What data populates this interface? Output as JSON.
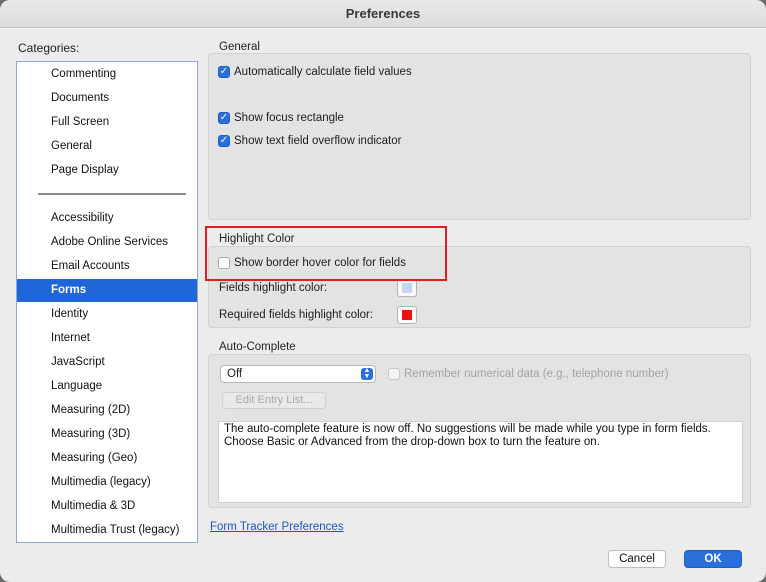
{
  "window": {
    "title": "Preferences"
  },
  "categories": {
    "label": "Categories:",
    "group1": [
      "Commenting",
      "Documents",
      "Full Screen",
      "General",
      "Page Display"
    ],
    "group2": [
      "Accessibility",
      "Adobe Online Services",
      "Email Accounts",
      "Forms",
      "Identity",
      "Internet",
      "JavaScript",
      "Language",
      "Measuring (2D)",
      "Measuring (3D)",
      "Measuring (Geo)",
      "Multimedia (legacy)",
      "Multimedia & 3D",
      "Multimedia Trust (legacy)"
    ],
    "selected": "Forms"
  },
  "general": {
    "title": "General",
    "auto_calc": {
      "label": "Automatically calculate field values",
      "checked": true
    },
    "focus_rect": {
      "label": "Show focus rectangle",
      "checked": true
    },
    "overflow": {
      "label": "Show text field overflow indicator",
      "checked": true
    }
  },
  "highlight": {
    "title": "Highlight Color",
    "border_hover": {
      "label": "Show border hover color for fields",
      "checked": false
    },
    "fields_color_label": "Fields highlight color:",
    "fields_color": "#c8d4f0",
    "required_color_label": "Required fields highlight color:",
    "required_color": "#ee1111"
  },
  "autocomplete": {
    "title": "Auto-Complete",
    "mode": "Off",
    "remember_numeric": {
      "label": "Remember numerical data (e.g., telephone number)",
      "checked": false,
      "enabled": false
    },
    "edit_entry_label": "Edit Entry List...",
    "description": "The auto-complete feature is now off. No suggestions will be made while you type in form fields. Choose Basic or Advanced from the drop-down box to turn the feature on."
  },
  "footer": {
    "tracker_link": "Form Tracker Preferences",
    "cancel_label": "Cancel",
    "ok_label": "OK"
  },
  "colors": {
    "accent": "#2066d8",
    "annotation": "#e02020"
  }
}
